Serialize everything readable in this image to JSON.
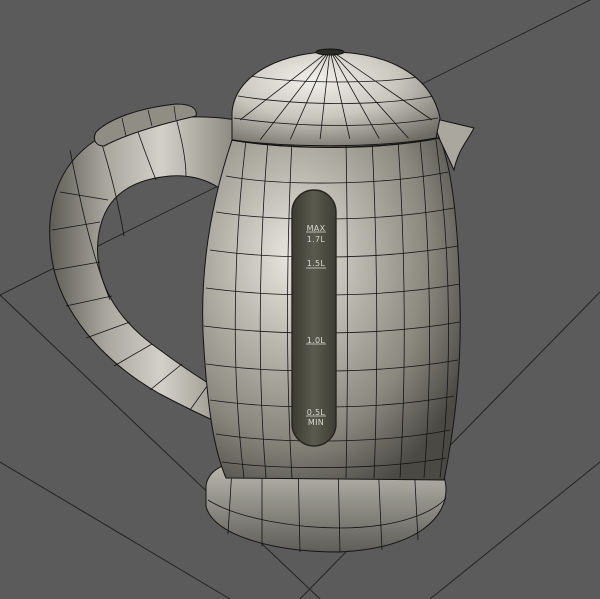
{
  "scene": {
    "background_color": "#5b5b5b",
    "grid_line_color": "#1f1f1f",
    "wire_color": "#141414",
    "body_color": "#8e8c82",
    "highlight_color": "#e4e2da",
    "shadow_color": "#3a3935",
    "gauge_window_color": "#4a493f"
  },
  "gauge": {
    "max_line1": "MAX",
    "max_line2": "1.7L",
    "mark_15": "1.5L",
    "mark_1": "1.0L",
    "min_line1": "0.5L",
    "min_line2": "MIN"
  }
}
